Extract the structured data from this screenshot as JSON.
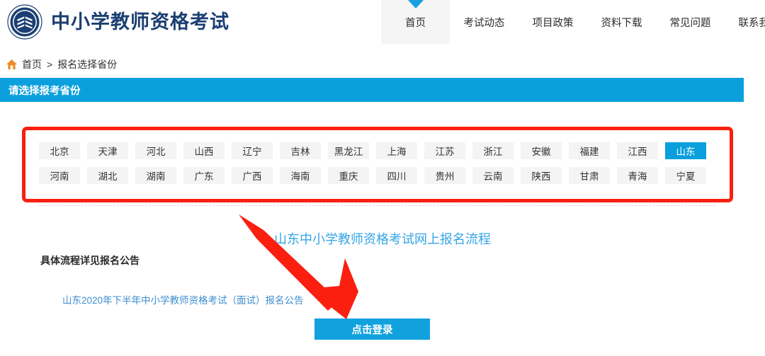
{
  "header": {
    "logo_icon": "book-emblem-logo-icon",
    "brand_title": "中小学教师资格考试",
    "nav": [
      {
        "label": "首页",
        "active": true
      },
      {
        "label": "考试动态",
        "active": false
      },
      {
        "label": "项目政策",
        "active": false
      },
      {
        "label": "资料下载",
        "active": false
      },
      {
        "label": "常见问题",
        "active": false
      },
      {
        "label": "联系我们",
        "active": false
      }
    ]
  },
  "breadcrumb": {
    "home_icon": "home-icon",
    "home_label": "首页",
    "separator": ">",
    "current_label": "报名选择省份"
  },
  "section": {
    "title": "请选择报考省份",
    "bar_color": "#0ba0dd"
  },
  "provinces": {
    "selected": "山东",
    "row1": [
      "北京",
      "天津",
      "河北",
      "山西",
      "辽宁",
      "吉林",
      "黑龙江",
      "上海",
      "江苏",
      "浙江",
      "安徽",
      "福建",
      "江西",
      "山东"
    ],
    "row2": [
      "河南",
      "湖北",
      "湖南",
      "广东",
      "广西",
      "海南",
      "重庆",
      "四川",
      "贵州",
      "云南",
      "陕西",
      "甘肃",
      "青海",
      "宁夏"
    ]
  },
  "flow": {
    "title": "山东中小学教师资格考试网上报名流程",
    "note": "具体流程详见报名公告",
    "announcement_link": "山东2020年下半年中小学教师资格考试（面试）报名公告"
  },
  "login": {
    "label": "点击登录",
    "color": "#11a2de"
  },
  "annotations": {
    "box_color": "#fb1f10",
    "arrow_color": "#fb1f10",
    "arrow_name": "red-pointer-arrow"
  }
}
